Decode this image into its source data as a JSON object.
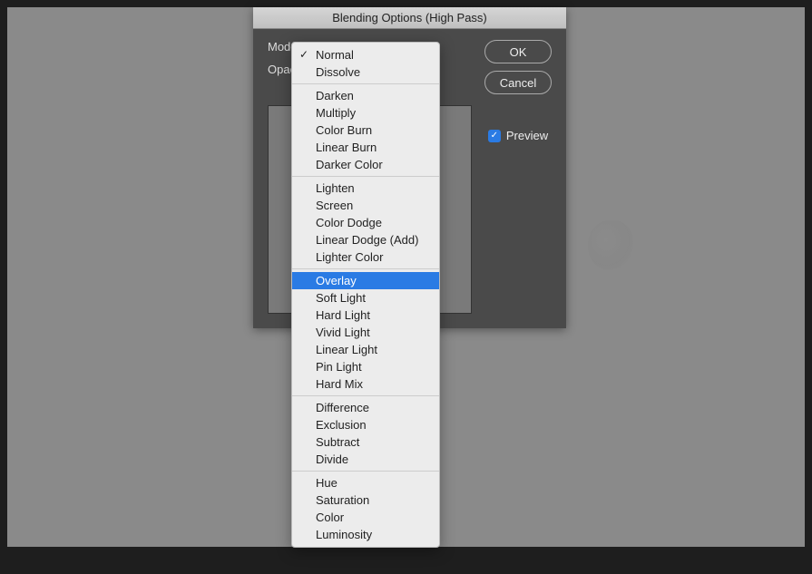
{
  "dialog": {
    "title": "Blending Options (High Pass)",
    "mode_label": "Mode:",
    "opacity_label": "Opac",
    "ok_label": "OK",
    "cancel_label": "Cancel",
    "preview_label": "Preview",
    "preview_checked": true
  },
  "dropdown": {
    "selected": "Normal",
    "highlighted": "Overlay",
    "groups": [
      [
        "Normal",
        "Dissolve"
      ],
      [
        "Darken",
        "Multiply",
        "Color Burn",
        "Linear Burn",
        "Darker Color"
      ],
      [
        "Lighten",
        "Screen",
        "Color Dodge",
        "Linear Dodge (Add)",
        "Lighter Color"
      ],
      [
        "Overlay",
        "Soft Light",
        "Hard Light",
        "Vivid Light",
        "Linear Light",
        "Pin Light",
        "Hard Mix"
      ],
      [
        "Difference",
        "Exclusion",
        "Subtract",
        "Divide"
      ],
      [
        "Hue",
        "Saturation",
        "Color",
        "Luminosity"
      ]
    ]
  }
}
